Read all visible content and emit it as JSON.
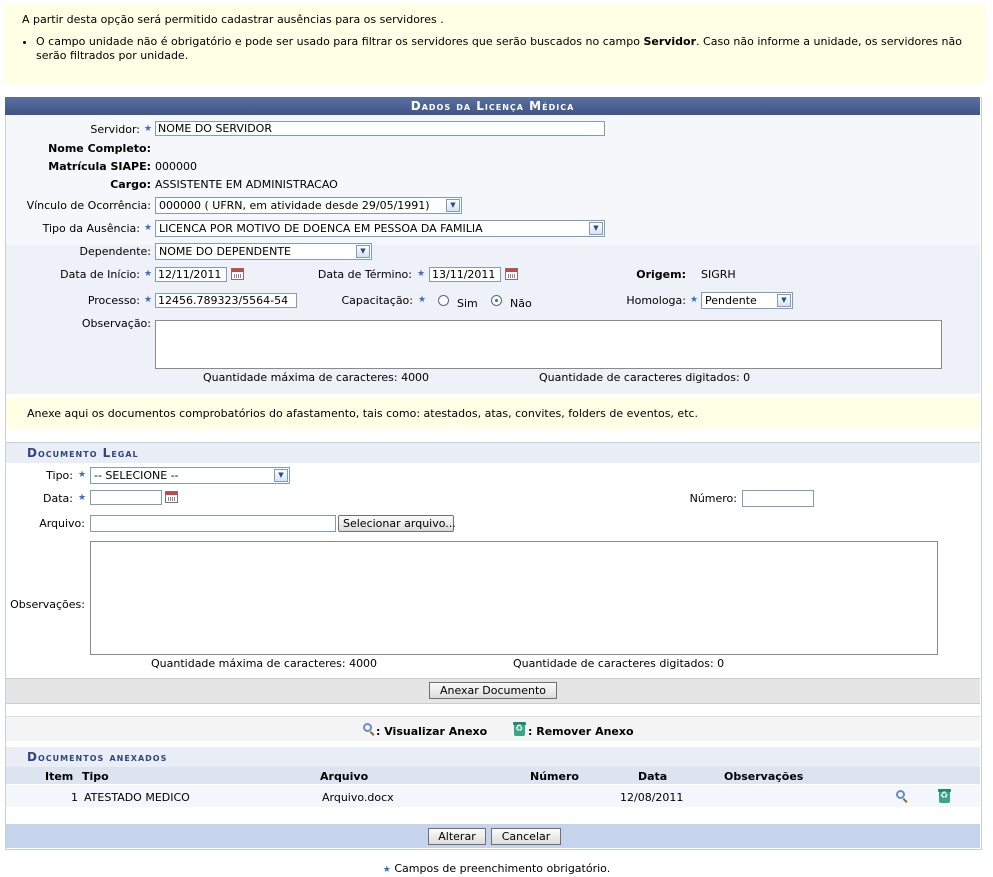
{
  "info": {
    "intro": "A partir desta opção será permitido cadastrar ausências para os servidores .",
    "bullet_pre": "O campo unidade não é obrigatório e pode ser usado para filtrar os servidores que serão buscados no campo ",
    "bullet_bold": "Servidor",
    "bullet_post": ". Caso não informe a unidade, os servidores não serão filtrados por unidade."
  },
  "form": {
    "caption": "Dados da Licença Médica",
    "servidor_label": "Servidor:",
    "servidor_value": "NOME DO SERVIDOR",
    "nome_completo_label": "Nome Completo:",
    "matricula_label": "Matrícula SIAPE:",
    "matricula_value": "000000",
    "cargo_label": "Cargo:",
    "cargo_value": "ASSISTENTE EM ADMINISTRACAO",
    "vinculo_label": "Vínculo de Ocorrência:",
    "vinculo_value": "000000  ( UFRN, em atividade desde 29/05/1991)",
    "tipo_ausencia_label": "Tipo da Ausência:",
    "tipo_ausencia_value": "LICENCA POR MOTIVO DE DOENCA EM PESSOA DA FAMILIA",
    "dependente_label": "Dependente:",
    "dependente_value": "NOME DO DEPENDENTE",
    "data_inicio_label": "Data de Início:",
    "data_inicio_value": "12/11/2011",
    "data_termino_label": "Data de Término:",
    "data_termino_value": "13/11/2011",
    "origem_label": "Origem:",
    "origem_value": "SIGRH",
    "processo_label": "Processo:",
    "processo_value": "12456.789323/5564-54",
    "capacitacao_label": "Capacitação:",
    "capacitacao_options": [
      "Sim",
      "Não"
    ],
    "capacitacao_selected": "Não",
    "homologa_label": "Homologa:",
    "homologa_value": "Pendente",
    "observacao_label": "Observação:",
    "max_chars": "Quantidade máxima de caracteres: 4000",
    "typed_chars": "Quantidade de caracteres digitados: 0"
  },
  "attach_notice": "Anexe aqui os documentos comprobatórios do afastamento, tais como: atestados, atas, convites, folders de eventos, etc.",
  "documento": {
    "caption": "Documento Legal",
    "tipo_label": "Tipo:",
    "tipo_value": "-- SELECIONE --",
    "data_label": "Data:",
    "numero_label": "Número:",
    "arquivo_label": "Arquivo:",
    "select_file_button": "Selecionar arquivo...",
    "observacoes_label": "Observações:",
    "max_chars": "Quantidade máxima de caracteres: 4000",
    "typed_chars": "Quantidade de caracteres digitados: 0",
    "attach_button": "Anexar Documento"
  },
  "legend": {
    "view": ": Visualizar Anexo",
    "remove": ": Remover Anexo"
  },
  "anexos": {
    "caption": "Documentos anexados",
    "columns": [
      "Item",
      "Tipo",
      "Arquivo",
      "Número",
      "Data",
      "Observações"
    ],
    "rows": [
      {
        "item": "1",
        "tipo": "ATESTADO MEDICO",
        "arquivo": "Arquivo.docx",
        "numero": "",
        "data": "12/08/2011",
        "observacoes": ""
      }
    ]
  },
  "actions": {
    "alterar": "Alterar",
    "cancelar": "Cancelar"
  },
  "footer": "Campos de preenchimento obrigatório.",
  "colors": {
    "caption_bg": "#3f5587",
    "required_star": "#3b6cc4",
    "notice_bg": "#ffffe6"
  }
}
